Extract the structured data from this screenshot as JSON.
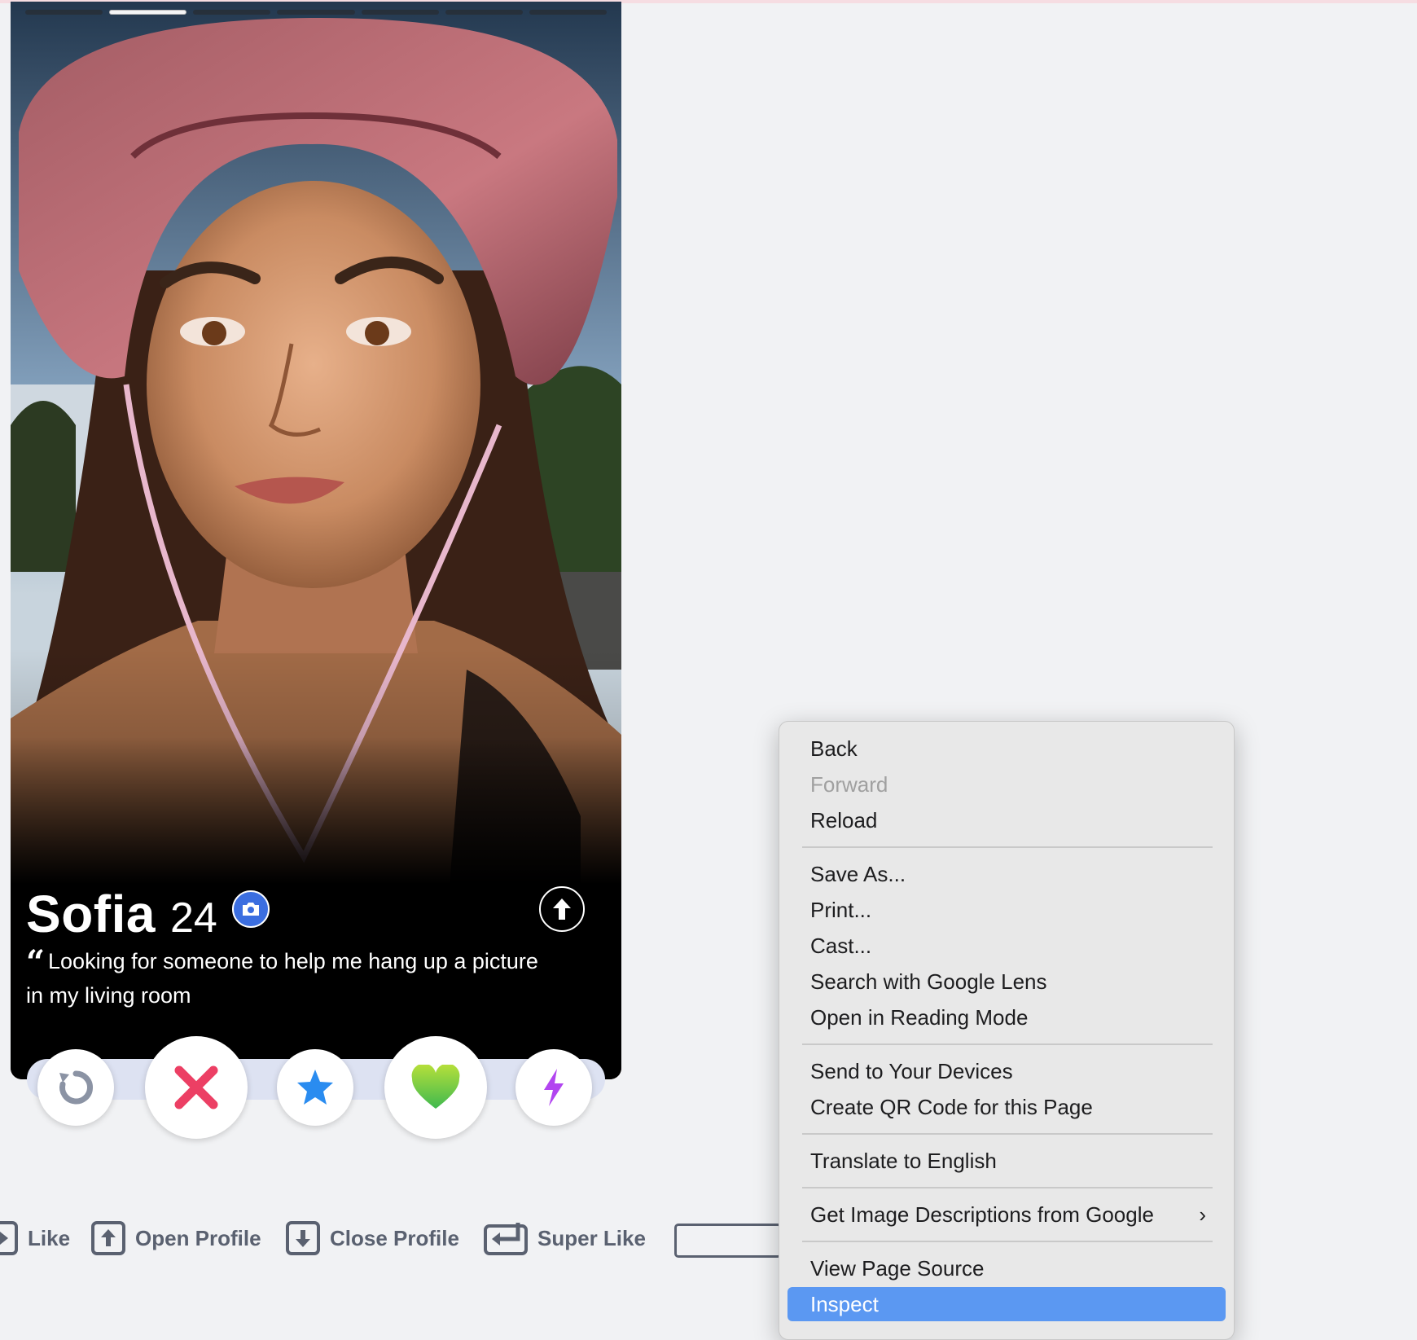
{
  "profile": {
    "name": "Sofia",
    "age": "24",
    "bio": "Looking for someone to help me hang up a picture in my living room",
    "photo_count": 7,
    "active_photo": 2
  },
  "actions": {
    "rewind": "rewind-icon",
    "nope": "x-icon",
    "super_like": "star-icon",
    "like": "heart-icon",
    "boost": "lightning-icon"
  },
  "shortcuts": [
    {
      "label": "Like"
    },
    {
      "label": "Open Profile"
    },
    {
      "label": "Close Profile"
    },
    {
      "label": "Super Like"
    }
  ],
  "context_menu": {
    "items": {
      "back": "Back",
      "forward": "Forward",
      "reload": "Reload",
      "save_as": "Save As...",
      "print": "Print...",
      "cast": "Cast...",
      "lens": "Search with Google Lens",
      "reading_mode": "Open in Reading Mode",
      "send_devices": "Send to Your Devices",
      "qr_code": "Create QR Code for this Page",
      "translate": "Translate to English",
      "image_descriptions": "Get Image Descriptions from Google",
      "view_source": "View Page Source",
      "inspect": "Inspect"
    },
    "submenu_glyph": "›"
  },
  "colors": {
    "menu_highlight": "#5b98f2",
    "badge_blue": "#3b6ee0",
    "nope_red": "#ec3f64",
    "superlike_blue": "#2a8cf0",
    "like_green": "#7fd13b",
    "boost_purple": "#b245f0"
  }
}
